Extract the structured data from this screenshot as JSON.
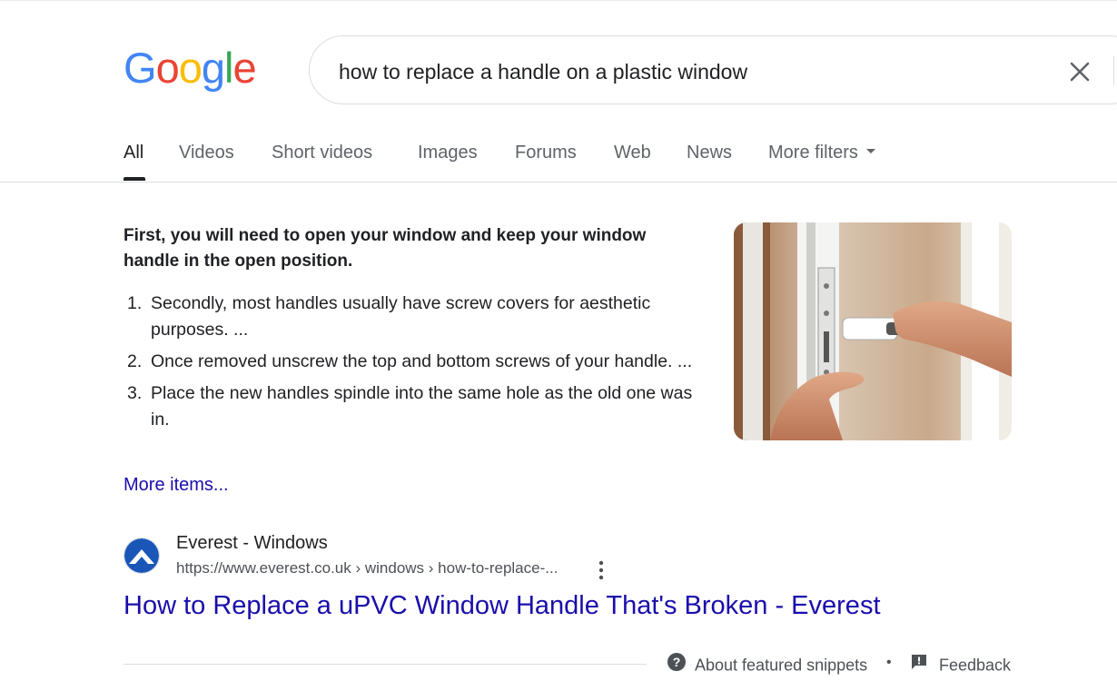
{
  "logo": {
    "letters": [
      "G",
      "o",
      "o",
      "g",
      "l",
      "e"
    ],
    "colors": [
      "#4285F4",
      "#EA4335",
      "#FBBC05",
      "#4285F4",
      "#34A853",
      "#EA4335"
    ]
  },
  "search": {
    "query": "how to replace a handle on a plastic window",
    "clear_icon": "close-icon"
  },
  "tabs": [
    {
      "label": "All",
      "active": true
    },
    {
      "label": "Videos"
    },
    {
      "label": "Short videos"
    },
    {
      "label": "Images"
    },
    {
      "label": "Forums"
    },
    {
      "label": "Web"
    },
    {
      "label": "News"
    },
    {
      "label": "More filters",
      "icon": "caret-down-icon"
    }
  ],
  "snippet": {
    "heading": "First, you will need to open your window and keep your window handle in the open position.",
    "items": [
      {
        "num": "1.",
        "text": "Secondly, most handles usually have screw covers for aesthetic purposes. ..."
      },
      {
        "num": "2.",
        "text": "Once removed unscrew the top and bottom screws of your handle. ..."
      },
      {
        "num": "3.",
        "text": "Place the new handles spindle into the same hole as the old one was in."
      }
    ],
    "more_items": "More items..."
  },
  "result": {
    "site_name": "Everest - Windows",
    "url": "https://www.everest.co.uk › windows › how-to-replace-...",
    "title": "How to Replace a uPVC Window Handle That's Broken - Everest"
  },
  "footer": {
    "about": "About featured snippets",
    "separator": "•",
    "feedback": "Feedback"
  },
  "colors": {
    "link": "#1a0dab",
    "text": "#202124",
    "muted": "#5f6368"
  }
}
